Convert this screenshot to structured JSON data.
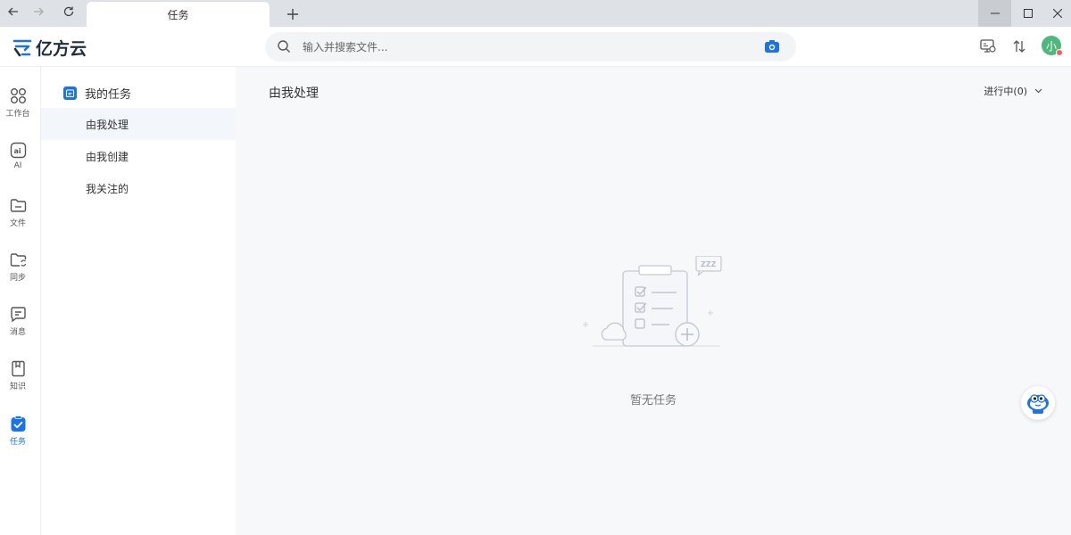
{
  "titlebar": {
    "tab_label": "任务",
    "new_tab_icon": "plus-icon",
    "nav_icons": [
      "arrow-left-icon",
      "arrow-right-icon",
      "refresh-icon"
    ],
    "window_icons": [
      "minimize-icon",
      "maximize-icon",
      "close-icon"
    ]
  },
  "header": {
    "logo_text": "亿方云",
    "search": {
      "placeholder": "输入并搜索文件..."
    },
    "avatar_text": "小",
    "icons": [
      "search-icon",
      "camera-icon",
      "screen-share-icon",
      "transfer-icon",
      "avatar"
    ]
  },
  "rail": {
    "items": [
      {
        "label": "工作台",
        "icon": "grid-icon"
      },
      {
        "label": "AI",
        "icon": "ai-icon"
      },
      {
        "label": "文件",
        "icon": "folder-icon"
      },
      {
        "label": "同步",
        "icon": "sync-folder-icon"
      },
      {
        "label": "消息",
        "icon": "message-icon"
      },
      {
        "label": "知识",
        "icon": "book-icon"
      },
      {
        "label": "任务",
        "icon": "task-check-icon"
      }
    ]
  },
  "subside": {
    "title": "我的任务",
    "items": [
      {
        "label": "由我处理"
      },
      {
        "label": "由我创建"
      },
      {
        "label": "我关注的"
      }
    ]
  },
  "main": {
    "title": "由我处理",
    "filter_label": "进行中(0)",
    "empty_text": "暂无任务",
    "empty_badge": "ZZZ"
  },
  "colors": {
    "accent": "#1a73e8",
    "avatar_bg": "#4cb97a",
    "main_bg": "#f7f8fa",
    "active_item_bg": "#f3f6fb"
  }
}
